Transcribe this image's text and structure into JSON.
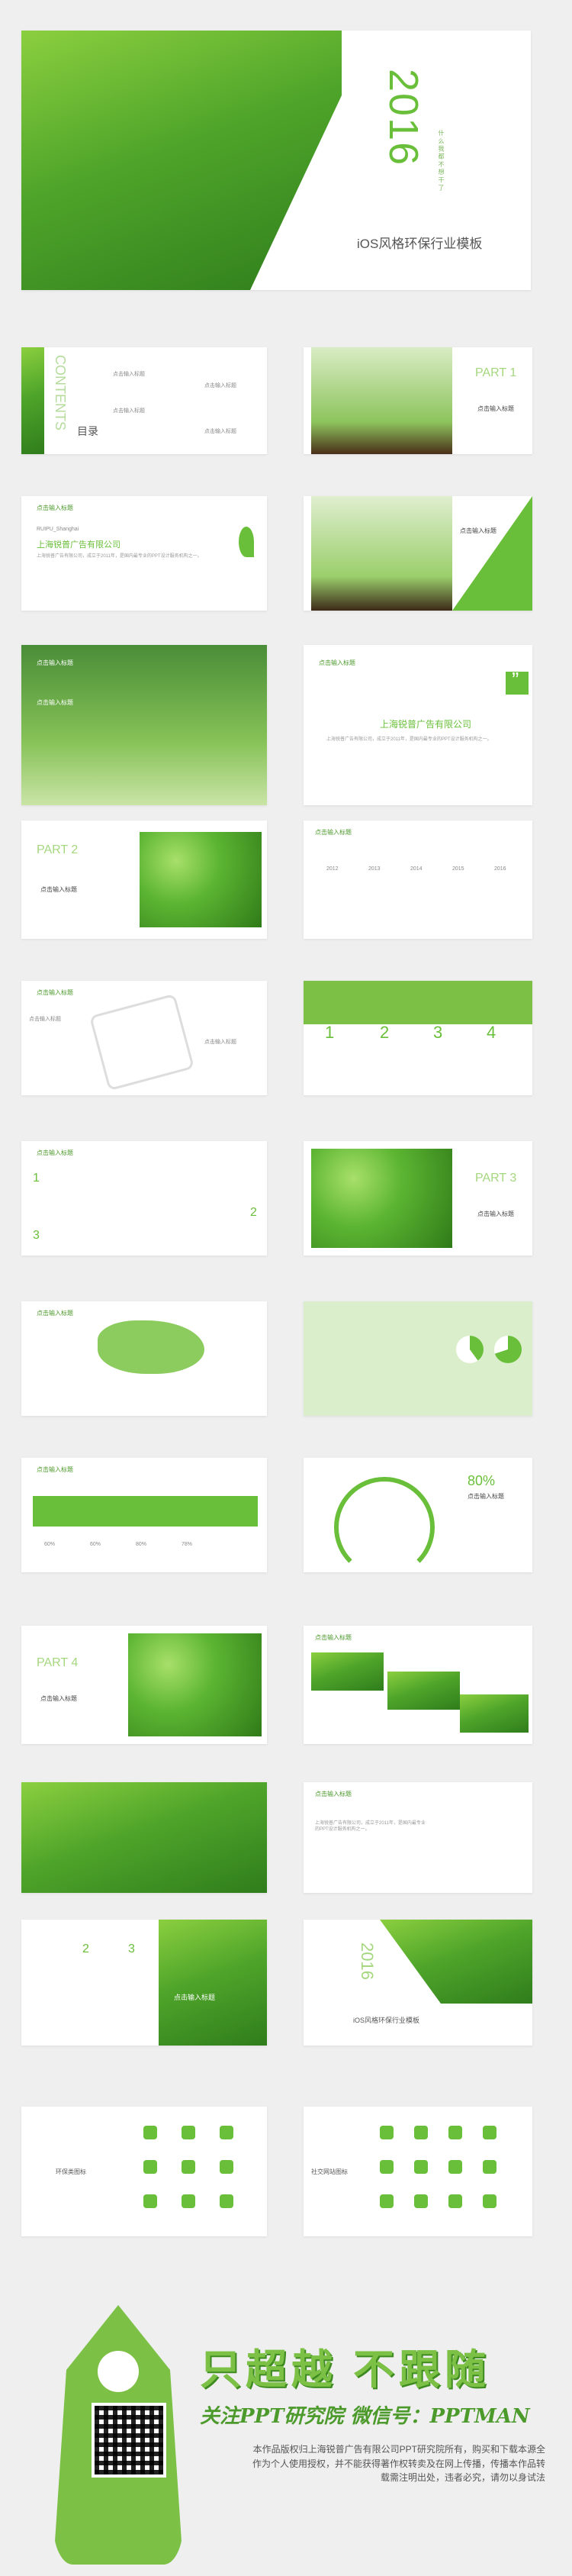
{
  "cover": {
    "year": "2016",
    "tagline": "什 么 我 都 不 想 干 了",
    "title": "iOS风格环保行业模板"
  },
  "toc": {
    "title": "目录",
    "contents": "CONTENTS",
    "items": [
      "点击输入标题",
      "点击输入标题",
      "点击输入标题",
      "点击输入标题"
    ]
  },
  "part1": {
    "label": "PART 1",
    "subtitle": "点击输入标题"
  },
  "part2": {
    "label": "PART 2",
    "subtitle": "点击输入标题"
  },
  "part3": {
    "label": "PART 3",
    "subtitle": "点击输入标题"
  },
  "part4": {
    "label": "PART 4",
    "subtitle": "点击输入标题"
  },
  "common": {
    "click_title": "点击输入标题",
    "company": "上海锐普广告有限公司",
    "company_en": "RUIPU_Shanghai",
    "body": "上海锐普广告有限公司，成立于2011年，是国内最专业的PPT设计服务机构之一。",
    "quote": "”"
  },
  "timeline": {
    "years": [
      "2012",
      "2013",
      "2014",
      "2015",
      "2016"
    ]
  },
  "numbers": [
    "1",
    "2",
    "3",
    "4"
  ],
  "steps": [
    "1",
    "2",
    "3"
  ],
  "percent": "80%",
  "stats": [
    "60%",
    "60%",
    "80%",
    "78%"
  ],
  "icon_slides": {
    "left_label": "环保类图标",
    "right_label": "社交网站图标"
  },
  "footer": {
    "slogan": "只超越 不跟随",
    "follow": "关注PPT研究院 微信号：PPTMAN",
    "copyright": "本作品版权归上海锐普广告有限公司PPT研究院所有，购买和下载本源全作为个人使用授权，并不能获得著作权转卖及在网上传播，传播本作品转载需注明出处，违者必究，请勿以身试法"
  },
  "colors": {
    "accent": "#6abf3a",
    "dark": "#3d8b20"
  }
}
